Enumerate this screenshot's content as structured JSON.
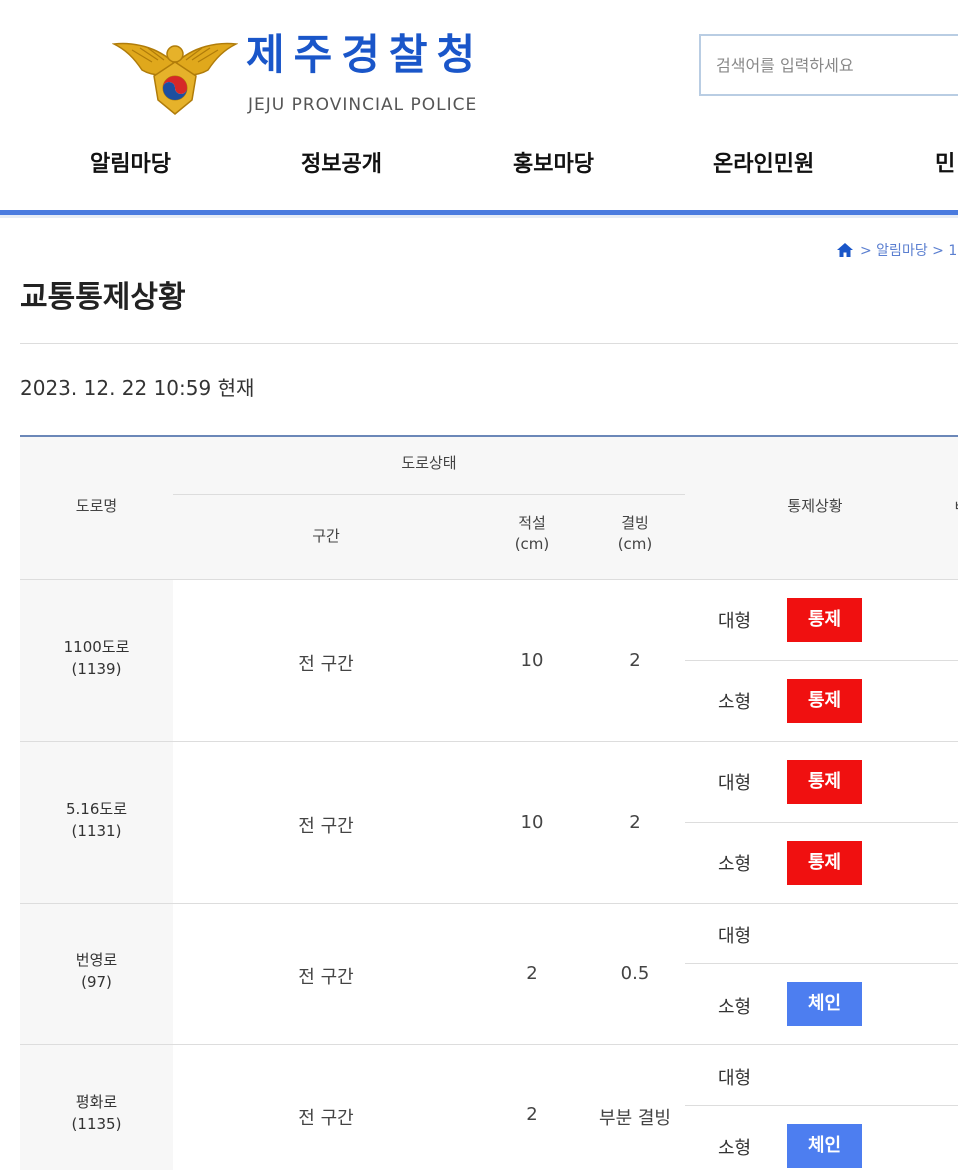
{
  "header": {
    "logo_title": "제주경찰청",
    "logo_subtitle": "JEJU PROVINCIAL POLICE",
    "search_placeholder": "검색어를 입력하세요"
  },
  "nav": [
    "알림마당",
    "정보공개",
    "홍보마당",
    "온라인민원",
    "민"
  ],
  "breadcrumb": "> 알림마당 > 1",
  "page_title": "교통통제상황",
  "timestamp": "2023. 12. 22 10:59 현재",
  "table": {
    "headers": {
      "road_name": "도로명",
      "road_status": "도로상태",
      "section": "구간",
      "snow": "적설\n(cm)",
      "ice": "결빙\n(cm)",
      "control": "통제상황",
      "last": "ㅂ"
    },
    "rows": [
      {
        "road": "1100도로",
        "code": "(1139)",
        "section": "전 구간",
        "snow": "10",
        "ice": "2",
        "large_label": "대형",
        "large_status": "통제",
        "small_label": "소형",
        "small_status": "통제"
      },
      {
        "road": "5.16도로",
        "code": "(1131)",
        "section": "전 구간",
        "snow": "10",
        "ice": "2",
        "large_label": "대형",
        "large_status": "통제",
        "small_label": "소형",
        "small_status": "통제"
      },
      {
        "road": "번영로",
        "code": "(97)",
        "section": "전 구간",
        "snow": "2",
        "ice": "0.5",
        "large_label": "대형",
        "large_status": "",
        "small_label": "소형",
        "small_status": "체인"
      },
      {
        "road": "평화로",
        "code": "(1135)",
        "section": "전 구간",
        "snow": "2",
        "ice": "부분 결빙",
        "large_label": "대형",
        "large_status": "",
        "small_label": "소형",
        "small_status": "체인"
      }
    ]
  },
  "colors": {
    "brand_blue": "#1a56c9",
    "nav_bar": "#4a7bdf",
    "control_red": "#f01010",
    "chain_blue": "#4d7ef0"
  }
}
